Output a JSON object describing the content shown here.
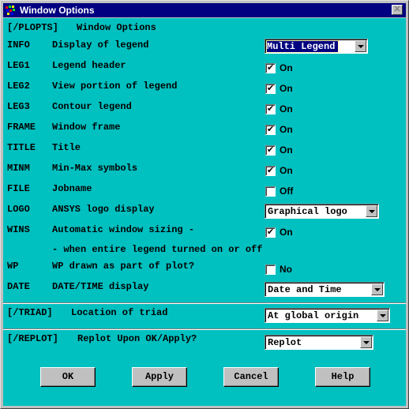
{
  "window": {
    "title": "Window Options",
    "close_icon": "close-x-icon",
    "app_icon": "ansys-app-icon"
  },
  "plopts": {
    "header_tag": "[/PLOPTS]",
    "header_desc": "Window Options",
    "rows": [
      {
        "key": "INFO",
        "desc": "Display of legend",
        "control": "combo",
        "value": "Multi Legend"
      },
      {
        "key": "LEG1",
        "desc": "Legend header",
        "control": "checkbox",
        "checked": true,
        "label": "On"
      },
      {
        "key": "LEG2",
        "desc": "View portion of legend",
        "control": "checkbox",
        "checked": true,
        "label": "On"
      },
      {
        "key": "LEG3",
        "desc": "Contour legend",
        "control": "checkbox",
        "checked": true,
        "label": "On"
      },
      {
        "key": "FRAME",
        "desc": "Window frame",
        "control": "checkbox",
        "checked": true,
        "label": "On"
      },
      {
        "key": "TITLE",
        "desc": "Title",
        "control": "checkbox",
        "checked": true,
        "label": "On"
      },
      {
        "key": "MINM",
        "desc": "Min-Max symbols",
        "control": "checkbox",
        "checked": true,
        "label": "On"
      },
      {
        "key": "FILE",
        "desc": "Jobname",
        "control": "checkbox",
        "checked": false,
        "label": "Off"
      },
      {
        "key": "LOGO",
        "desc": "ANSYS logo display",
        "control": "combo",
        "value": "Graphical logo"
      },
      {
        "key": "WINS",
        "desc": "Automatic window sizing -",
        "control": "checkbox",
        "checked": true,
        "label": "On"
      },
      {
        "key": "",
        "desc": "- when entire legend turned on or off",
        "control": "none"
      },
      {
        "key": "WP",
        "desc": "WP drawn as part of plot?",
        "control": "checkbox",
        "checked": false,
        "label": "No"
      },
      {
        "key": "DATE",
        "desc": "DATE/TIME display",
        "control": "combo",
        "value": "Date and Time"
      }
    ]
  },
  "triad": {
    "tag": "[/TRIAD]",
    "desc": "Location of triad",
    "value": "At global origin"
  },
  "replot": {
    "tag": "[/REPLOT]",
    "desc": "Replot Upon OK/Apply?",
    "value": "Replot"
  },
  "buttons": {
    "ok": "OK",
    "apply": "Apply",
    "cancel": "Cancel",
    "help": "Help"
  },
  "check_glyph": "✔",
  "colors": {
    "client_bg": "#00c0c0",
    "titlebar": "#000080",
    "face": "#c0c0c0"
  }
}
